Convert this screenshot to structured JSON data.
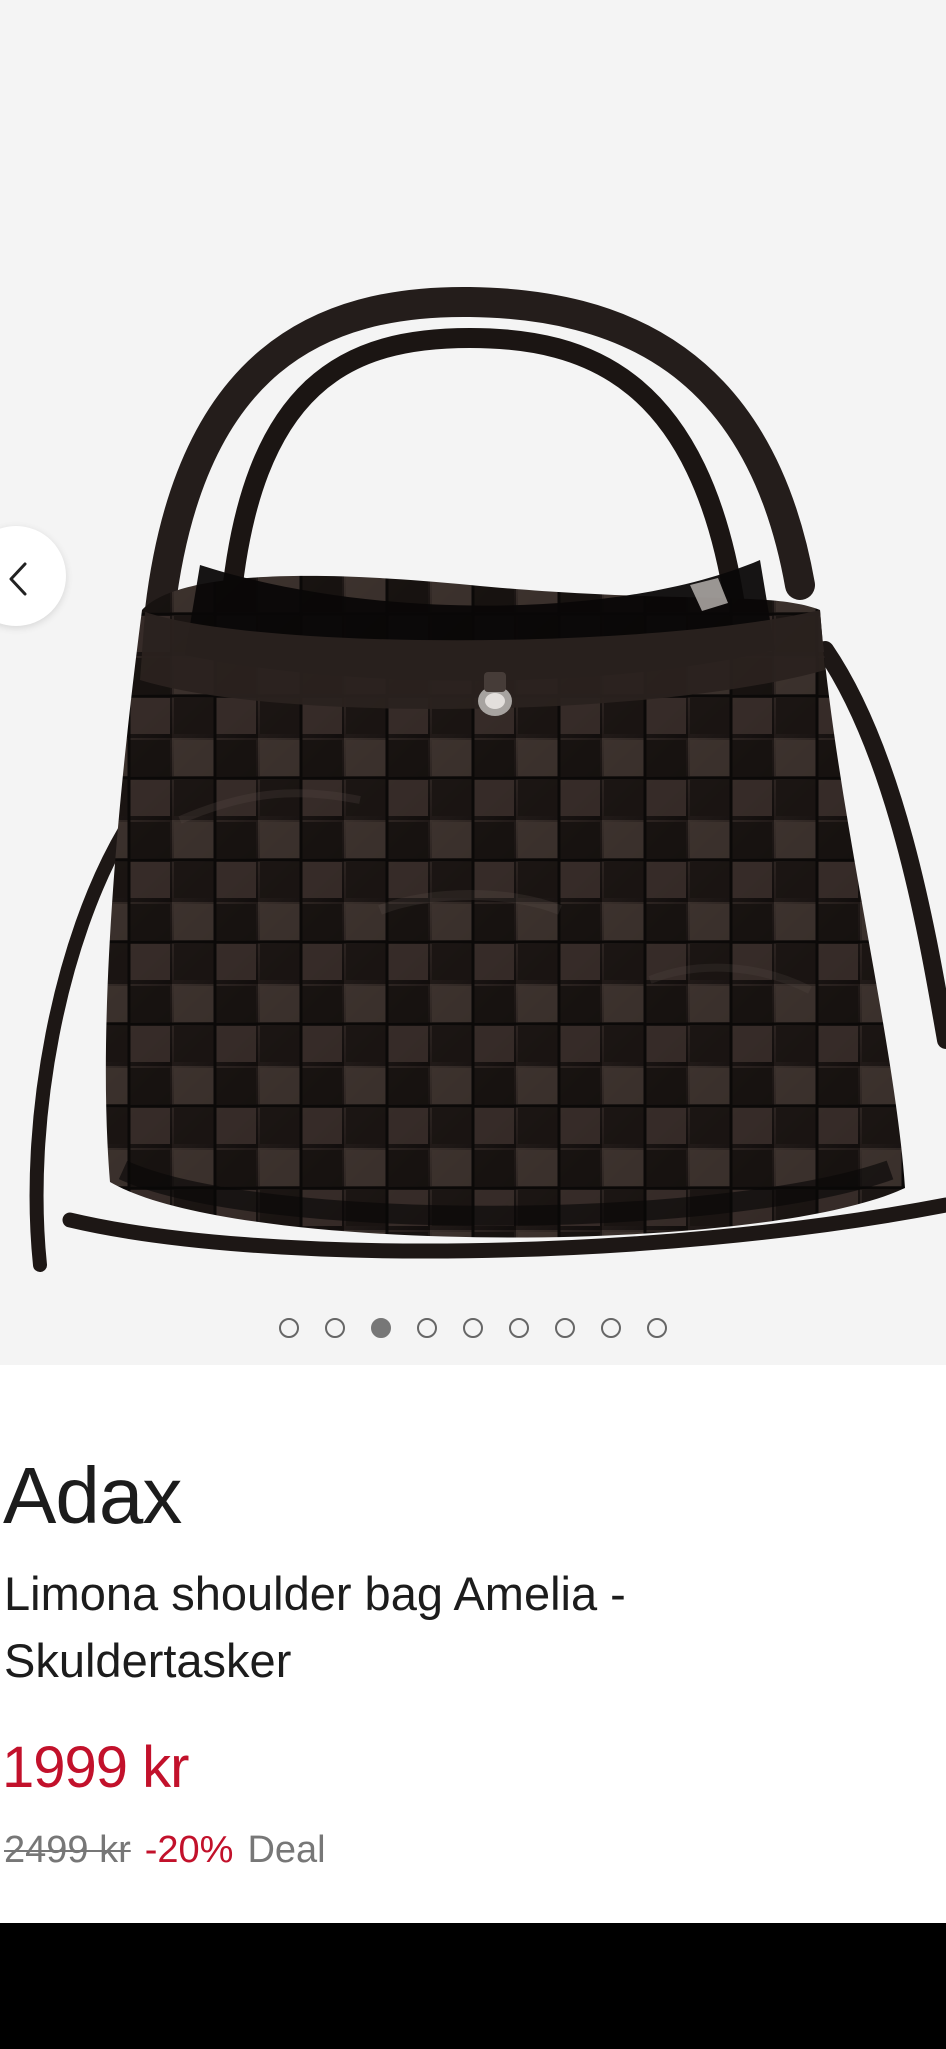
{
  "gallery": {
    "prev_icon": "chevron-left-icon",
    "dot_count": 9,
    "active_index": 2
  },
  "product": {
    "brand": "Adax",
    "name": "Limona shoulder bag Amelia - Skuldertasker",
    "price": "1999 kr",
    "old_price": "2499 kr",
    "discount": "-20%",
    "deal": "Deal"
  },
  "colors": {
    "price": "#c2112b",
    "muted": "#777777",
    "gallery_bg": "#f4f4f4"
  }
}
